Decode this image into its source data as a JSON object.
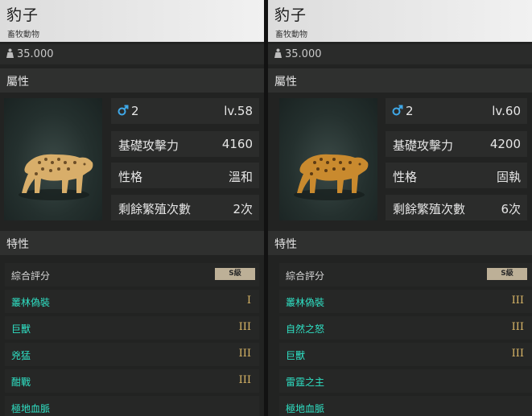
{
  "panels": [
    {
      "title": "豹子",
      "subtitle": "畜牧動物",
      "weight": "35.000",
      "attributes_header": "屬性",
      "gender_count": "2",
      "level": "lv.58",
      "stats": [
        {
          "label": "基礎攻擊力",
          "value": "4160"
        },
        {
          "label": "性格",
          "value": "溫和"
        },
        {
          "label": "剩餘繁殖次數",
          "value": "2次"
        }
      ],
      "traits_header": "特性",
      "overall_label": "綜合評分",
      "overall_grade": "S級",
      "traits": [
        {
          "name": "叢林偽裝",
          "level": "I"
        },
        {
          "name": "巨獸",
          "level": "III"
        },
        {
          "name": "兇猛",
          "level": "III"
        },
        {
          "name": "酣戰",
          "level": "III"
        },
        {
          "name": "極地血脈",
          "level": ""
        }
      ]
    },
    {
      "title": "豹子",
      "subtitle": "畜牧動物",
      "weight": "35.000",
      "attributes_header": "屬性",
      "gender_count": "2",
      "level": "lv.60",
      "stats": [
        {
          "label": "基礎攻擊力",
          "value": "4200"
        },
        {
          "label": "性格",
          "value": "固執"
        },
        {
          "label": "剩餘繁殖次數",
          "value": "6次"
        }
      ],
      "traits_header": "特性",
      "overall_label": "綜合評分",
      "overall_grade": "S級",
      "traits": [
        {
          "name": "叢林偽裝",
          "level": "III"
        },
        {
          "name": "自然之怒",
          "level": "III"
        },
        {
          "name": "巨獸",
          "level": "III"
        },
        {
          "name": "雷霆之主",
          "level": ""
        },
        {
          "name": "極地血脈",
          "level": ""
        }
      ]
    }
  ],
  "colors": {
    "trait_name": "#2fe0c4",
    "trait_level": "#d8b566",
    "male_icon": "#3fa8e8",
    "grade_badge": "#bdb097"
  }
}
